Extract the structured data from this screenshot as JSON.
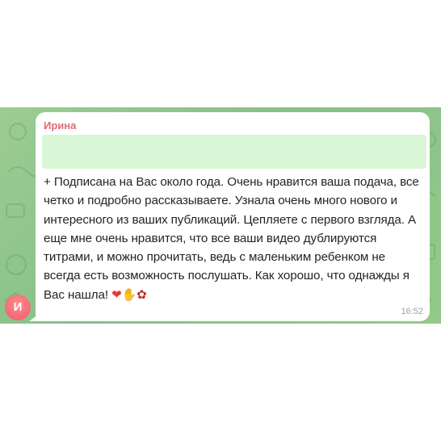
{
  "message": {
    "sender": "Ирина",
    "avatar_initial": "И",
    "quote_text": "",
    "prefix": "+ ",
    "text": "Подписана на Вас около года. Очень нравится ваша подача, все четко и подробно рассказываете. Узнала очень много нового и интересного из ваших публикаций. Цепляете с первого взгляда. А еще мне очень нравится, что все ваши видео дублируются титрами, и можно прочитать, ведь с маленьким ребенком не всегда есть возможность послушать. Как хорошо, что однажды я Вас нашла!",
    "emojis": [
      "heart-icon",
      "thumbs-up-icon",
      "rose-icon"
    ],
    "time": "16:52"
  },
  "colors": {
    "chat_background": "#8fc58a",
    "bubble": "#ffffff",
    "sender_name": "#e06c75",
    "quote_block": "#d9f7d6",
    "avatar": "#ef5b6b"
  }
}
